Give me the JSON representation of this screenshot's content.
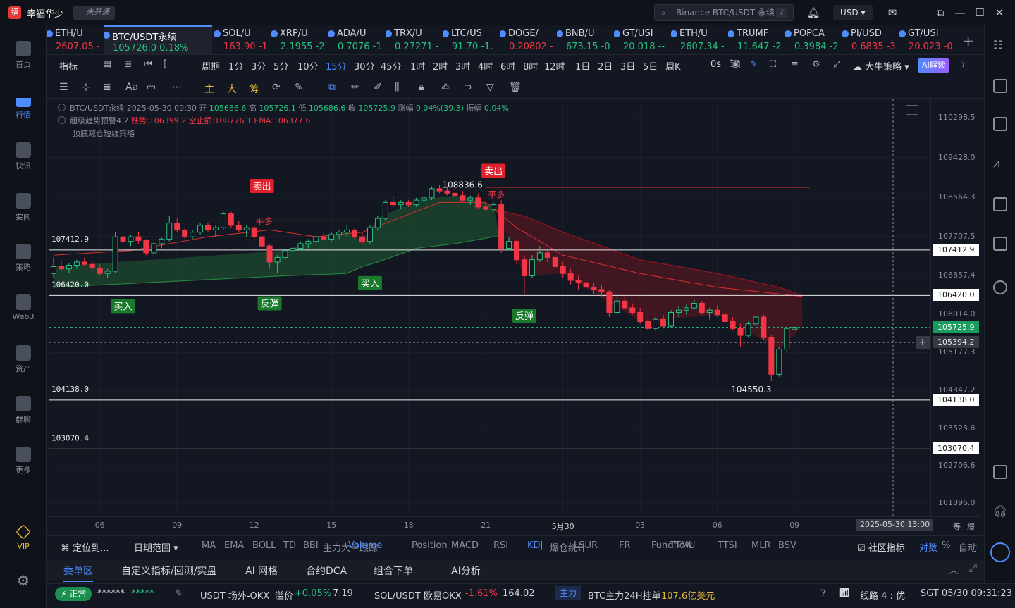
{
  "titlebar": {
    "app_name": "幸福华少",
    "badge": "未开通",
    "search_placeholder": "Binance BTC/USDT 永续",
    "search_shortcut": "/",
    "currency": "USD"
  },
  "leftnav": [
    {
      "label": "首页",
      "icon": "home-icon"
    },
    {
      "label": "行情",
      "icon": "chart-bar-icon",
      "active": true
    },
    {
      "label": "快讯",
      "icon": "news-icon"
    },
    {
      "label": "要闻",
      "icon": "document-icon"
    },
    {
      "label": "策略",
      "icon": "robot-icon"
    },
    {
      "label": "Web3",
      "icon": "web3-icon"
    },
    {
      "label": "资产",
      "icon": "wallet-icon"
    },
    {
      "label": "群聊",
      "icon": "chat-icon"
    },
    {
      "label": "更多",
      "icon": "grid-icon"
    },
    {
      "label": "VIP",
      "icon": "diamond-icon"
    }
  ],
  "tickers": [
    {
      "sym": "ETH/U",
      "price": "2607.05",
      "chg": "-",
      "dir": "down"
    },
    {
      "sym": "BTC/USDT永续",
      "price": "105726.0",
      "chg": "0.18%",
      "dir": "up",
      "active": true
    },
    {
      "sym": "SOL/U",
      "price": "163.90",
      "chg": "-1",
      "dir": "down"
    },
    {
      "sym": "XRP/U",
      "price": "2.1955",
      "chg": "-2",
      "dir": "up"
    },
    {
      "sym": "ADA/U",
      "price": "0.7076",
      "chg": "-1",
      "dir": "up"
    },
    {
      "sym": "TRX/U",
      "price": "0.27271",
      "chg": "-",
      "dir": "up"
    },
    {
      "sym": "LTC/US",
      "price": "91.70",
      "chg": "-1.",
      "dir": "up"
    },
    {
      "sym": "DOGE/",
      "price": "0.20802",
      "chg": "-",
      "dir": "down"
    },
    {
      "sym": "BNB/U",
      "price": "673.15",
      "chg": "-0",
      "dir": "up"
    },
    {
      "sym": "GT/USI",
      "price": "20.018",
      "chg": "--",
      "dir": "up"
    },
    {
      "sym": "ETH/U",
      "price": "2607.34",
      "chg": "-",
      "dir": "up"
    },
    {
      "sym": "TRUMF",
      "price": "11.647",
      "chg": "-2",
      "dir": "up"
    },
    {
      "sym": "POPCA",
      "price": "0.3984",
      "chg": "-2",
      "dir": "up"
    },
    {
      "sym": "PI/USD",
      "price": "0.6835",
      "chg": "-3",
      "dir": "down"
    },
    {
      "sym": "GT/USI",
      "price": "20.023",
      "chg": "-0",
      "dir": "down"
    }
  ],
  "intervals": [
    "指标",
    "周期",
    "1分",
    "3分",
    "5分",
    "10分",
    "15分",
    "30分",
    "45分",
    "1时",
    "2时",
    "3时",
    "4时",
    "6时",
    "8时",
    "12时",
    "1日",
    "2日",
    "3日",
    "5日",
    "周K",
    "0s"
  ],
  "active_interval": "15分",
  "strategy_label": "大牛策略",
  "ai_label": "AI解读",
  "draw_text": [
    "Aa",
    "主",
    "大",
    "筹"
  ],
  "legend": {
    "line1_prefix": "BTC/USDT永续 2025-05-30 09:30",
    "open_l": "开",
    "open": "105686.6",
    "high_l": "高",
    "high": "105726.1",
    "low_l": "低",
    "low": "105686.6",
    "close_l": "收",
    "close": "105725.9",
    "chg_l": "涨幅",
    "chg": "0.04%(39.3)",
    "amp_l": "振幅",
    "amp": "0.04%",
    "line2_name": "超级趋势预警4.2",
    "line2_a": "跌势:106399.2",
    "line2_b": "空止损:108776.1",
    "line2_c": "EMA:106377.6",
    "line3": "顶底减仓短线策略"
  },
  "price_ticks": [
    "110298.5",
    "109428.0",
    "108564.3",
    "107707.5",
    "106857.4",
    "106014.0",
    "105177.3",
    "104347.2",
    "103523.6",
    "102706.6",
    "101896.0"
  ],
  "hlines": [
    {
      "price": "107412.9"
    },
    {
      "price": "106420.0"
    },
    {
      "price": "104138.0"
    },
    {
      "price": "103070.4"
    }
  ],
  "current_price": "105725.9",
  "cursor_price": "105394.2",
  "annotations": {
    "sell": "卖出",
    "buy": "买入",
    "rebound": "反弹",
    "close_long": "平多",
    "high": "108836.6",
    "low": "104550.3"
  },
  "time_ticks": [
    "06",
    "09",
    "12",
    "15",
    "18",
    "21",
    "5月30",
    "03",
    "06",
    "09"
  ],
  "cursor_time": "2025-05-30 13:00",
  "axis_toggles": [
    "等",
    "爆"
  ],
  "indicator_bar": {
    "locate": "定位到...",
    "range": "日期范围",
    "items": [
      "MA",
      "EMA",
      "BOLL",
      "TD",
      "BBI",
      "主力大单跟踪",
      "Volume",
      "Position",
      "MACD",
      "RSI",
      "KDJ",
      "爆仓统计",
      "LSUR",
      "FR",
      "Fundflow",
      "TTMU",
      "TTSI",
      "MLR",
      "BSV"
    ],
    "community": "社区指标",
    "log": "对数",
    "pct": "%",
    "auto": "自动"
  },
  "panel_tabs": [
    "委单区",
    "自定义指标/回测/实盘",
    "AI 网格",
    "合约DCA",
    "组合下单",
    "AI分析"
  ],
  "statusbar": {
    "status": "正常",
    "user": "******",
    "stars": "*****",
    "usdt_label": "USDT 场外-OKX",
    "premium_label": "溢价",
    "premium": "+0.05%",
    "usdt_price": "7.19",
    "sol_label": "SOL/USDT 欧易OKX",
    "sol_chg": "-1.61%",
    "sol_price": "164.02",
    "main_tag": "主力",
    "btc_label": "BTC主力24H挂单",
    "btc_value": "107.6亿美元",
    "line_label": "线路 4 : 优",
    "time": "SGT 05/30 09:31:23"
  },
  "colors": {
    "up": "#26c281",
    "down": "#f23645",
    "accent": "#4f8cff",
    "bg": "#131722"
  },
  "chart_data": {
    "type": "candlestick",
    "price_range": [
      101600,
      110700
    ],
    "candles": [
      [
        106900,
        107250,
        106800,
        107050
      ],
      [
        107050,
        107180,
        106950,
        107000
      ],
      [
        107000,
        107120,
        106900,
        107080
      ],
      [
        107080,
        107200,
        107000,
        107150
      ],
      [
        107150,
        107250,
        107050,
        107100
      ],
      [
        107100,
        107180,
        106950,
        107020
      ],
      [
        107020,
        107100,
        106850,
        106900
      ],
      [
        106900,
        107000,
        106800,
        106950
      ],
      [
        106950,
        107800,
        106900,
        107700
      ],
      [
        107700,
        107850,
        107550,
        107600
      ],
      [
        107600,
        107750,
        107500,
        107700
      ],
      [
        107700,
        107800,
        107550,
        107620
      ],
      [
        107620,
        107650,
        107300,
        107350
      ],
      [
        107350,
        107600,
        107300,
        107550
      ],
      [
        107550,
        107700,
        107450,
        107650
      ],
      [
        107650,
        108150,
        107600,
        108000
      ],
      [
        108000,
        108100,
        107800,
        107850
      ],
      [
        107850,
        107900,
        107650,
        107700
      ],
      [
        107700,
        107850,
        107650,
        107800
      ],
      [
        107800,
        108000,
        107750,
        107950
      ],
      [
        107950,
        108000,
        107800,
        107850
      ],
      [
        107850,
        107950,
        107700,
        107900
      ],
      [
        107900,
        108250,
        107850,
        108200
      ],
      [
        108200,
        108250,
        107900,
        107950
      ],
      [
        107950,
        108050,
        107800,
        107850
      ],
      [
        107850,
        107950,
        107700,
        107900
      ],
      [
        107900,
        107950,
        107600,
        107700
      ],
      [
        107700,
        107750,
        107400,
        107500
      ],
      [
        107500,
        107550,
        107000,
        107150
      ],
      [
        107150,
        107300,
        106900,
        107250
      ],
      [
        107250,
        107450,
        107200,
        107400
      ],
      [
        107400,
        107500,
        107300,
        107450
      ],
      [
        107450,
        107600,
        107400,
        107550
      ],
      [
        107550,
        107650,
        107450,
        107600
      ],
      [
        107600,
        107750,
        107550,
        107700
      ],
      [
        107700,
        107800,
        107600,
        107650
      ],
      [
        107650,
        107800,
        107600,
        107750
      ],
      [
        107750,
        107850,
        107650,
        107800
      ],
      [
        107800,
        107950,
        107700,
        107850
      ],
      [
        107850,
        107900,
        107650,
        107700
      ],
      [
        107700,
        107800,
        107550,
        107600
      ],
      [
        107600,
        107950,
        107550,
        107900
      ],
      [
        107900,
        108150,
        107850,
        108100
      ],
      [
        108100,
        108500,
        108050,
        108450
      ],
      [
        108450,
        108600,
        108350,
        108400
      ],
      [
        108400,
        108500,
        108300,
        108450
      ],
      [
        108450,
        108500,
        108350,
        108400
      ],
      [
        108400,
        108550,
        108350,
        108500
      ],
      [
        108500,
        108600,
        108400,
        108550
      ],
      [
        108550,
        108800,
        108500,
        108750
      ],
      [
        108750,
        108836,
        108650,
        108700
      ],
      [
        108700,
        108800,
        108600,
        108650
      ],
      [
        108650,
        108750,
        108550,
        108600
      ],
      [
        108600,
        108700,
        108450,
        108500
      ],
      [
        108500,
        108600,
        108400,
        108550
      ],
      [
        108550,
        108650,
        108300,
        108350
      ],
      [
        108350,
        108450,
        108250,
        108300
      ],
      [
        108300,
        108450,
        108250,
        108400
      ],
      [
        108400,
        108500,
        107350,
        107450
      ],
      [
        107450,
        107700,
        107400,
        107600
      ],
      [
        107600,
        107650,
        107100,
        107200
      ],
      [
        107200,
        107300,
        106450,
        106850
      ],
      [
        106850,
        107300,
        106800,
        107200
      ],
      [
        107200,
        107500,
        107150,
        107350
      ],
      [
        107350,
        107400,
        107150,
        107250
      ],
      [
        107250,
        107300,
        107000,
        107050
      ],
      [
        107050,
        107150,
        106800,
        106900
      ],
      [
        106900,
        107000,
        106650,
        106750
      ],
      [
        106750,
        106850,
        106550,
        106700
      ],
      [
        106700,
        106800,
        106550,
        106600
      ],
      [
        106600,
        106700,
        106450,
        106550
      ],
      [
        106550,
        106650,
        106400,
        106500
      ],
      [
        106500,
        106550,
        105950,
        106050
      ],
      [
        106050,
        106400,
        106000,
        106300
      ],
      [
        106300,
        106450,
        106100,
        106150
      ],
      [
        106150,
        106250,
        106000,
        106050
      ],
      [
        106050,
        106150,
        105800,
        105850
      ],
      [
        105850,
        105900,
        105650,
        105700
      ],
      [
        105700,
        105950,
        105650,
        105900
      ],
      [
        105900,
        106000,
        105700,
        105750
      ],
      [
        105750,
        106100,
        105700,
        106050
      ],
      [
        106050,
        106200,
        105950,
        106100
      ],
      [
        106100,
        106250,
        106000,
        106150
      ],
      [
        106150,
        106350,
        106100,
        106250
      ],
      [
        106250,
        106300,
        106000,
        106050
      ],
      [
        106050,
        106150,
        105900,
        106100
      ],
      [
        106100,
        106200,
        105950,
        106000
      ],
      [
        106000,
        106100,
        105800,
        105850
      ],
      [
        105850,
        105950,
        105650,
        105700
      ],
      [
        105700,
        105800,
        105300,
        105550
      ],
      [
        105550,
        105850,
        105500,
        105800
      ],
      [
        105800,
        106000,
        105750,
        105950
      ],
      [
        105950,
        106000,
        105450,
        105500
      ],
      [
        105500,
        105550,
        104550,
        104700
      ],
      [
        104700,
        105300,
        104650,
        105250
      ],
      [
        105250,
        105750,
        105200,
        105700
      ],
      [
        105686,
        105726,
        105686,
        105726
      ]
    ]
  }
}
